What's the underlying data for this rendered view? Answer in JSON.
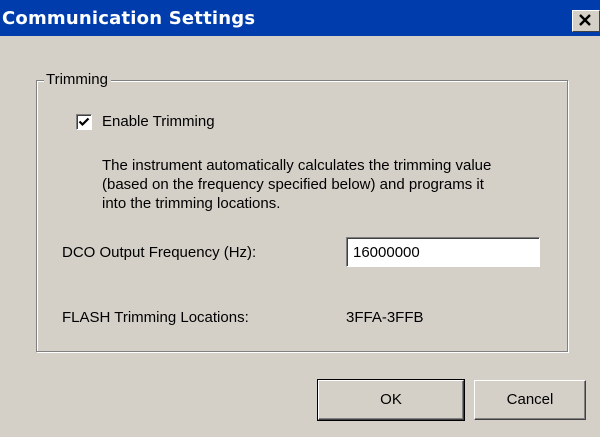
{
  "window": {
    "title": "Communication Settings",
    "close_icon": "close-icon"
  },
  "trimming": {
    "group_label": "Trimming",
    "enable_label": "Enable Trimming",
    "enable_checked": true,
    "description_lines": [
      "The instrument automatically calculates the trimming value",
      "(based on the frequency specified below) and programs it",
      "into the trimming locations."
    ],
    "dco_label": "DCO Output Frequency (Hz):",
    "dco_value": "16000000",
    "flash_label": "FLASH Trimming Locations:",
    "flash_value": "3FFA-3FFB"
  },
  "buttons": {
    "ok": "OK",
    "cancel": "Cancel"
  },
  "colors": {
    "titlebar": "#003cac",
    "dialog_bg": "#d4d0c8"
  }
}
